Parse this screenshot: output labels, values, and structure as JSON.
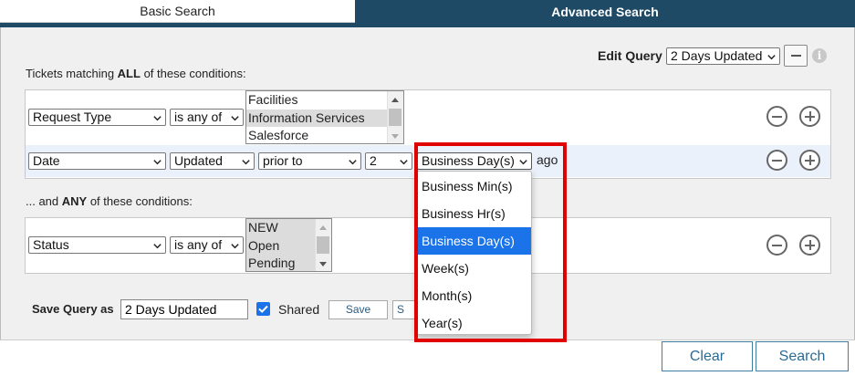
{
  "tabs": {
    "basic": "Basic Search",
    "advanced": "Advanced Search"
  },
  "edit_query": {
    "label": "Edit Query",
    "selected": "2 Days Updated"
  },
  "all_section": {
    "prefix": "Tickets matching ",
    "emphasis": "ALL",
    "suffix": " of these conditions:",
    "rows": [
      {
        "field": "Request Type",
        "operator": "is any of",
        "options": [
          "Facilities",
          "Information Services",
          "Salesforce"
        ]
      },
      {
        "field": "Date",
        "sub_field": "Updated",
        "operator": "prior to",
        "amount": "2",
        "unit": "Business Day(s)",
        "suffix": "ago"
      }
    ]
  },
  "any_section": {
    "prefix": "... and ",
    "emphasis": "ANY",
    "suffix": " of these conditions:",
    "rows": [
      {
        "field": "Status",
        "operator": "is any of",
        "options": [
          "NEW",
          "Open",
          "Pending"
        ]
      }
    ]
  },
  "unit_dropdown": {
    "options": [
      "Business Min(s)",
      "Business Hr(s)",
      "Business Day(s)",
      "Week(s)",
      "Month(s)",
      "Year(s)"
    ],
    "selected_index": 2
  },
  "save": {
    "label": "Save Query as",
    "value": "2 Days Updated",
    "shared_label": "Shared",
    "shared_checked": true,
    "save_button": "Save",
    "save_as_button": "S"
  },
  "footer": {
    "clear": "Clear",
    "search": "Search"
  },
  "colors": {
    "tab_active_bg": "#1e4a66",
    "accent": "#1a73e8",
    "highlight_frame": "#e00000"
  },
  "icons": [
    "minus-icon",
    "info-icon",
    "remove-condition-icon",
    "add-condition-icon",
    "chevron-down-icon",
    "checkmark-icon"
  ]
}
